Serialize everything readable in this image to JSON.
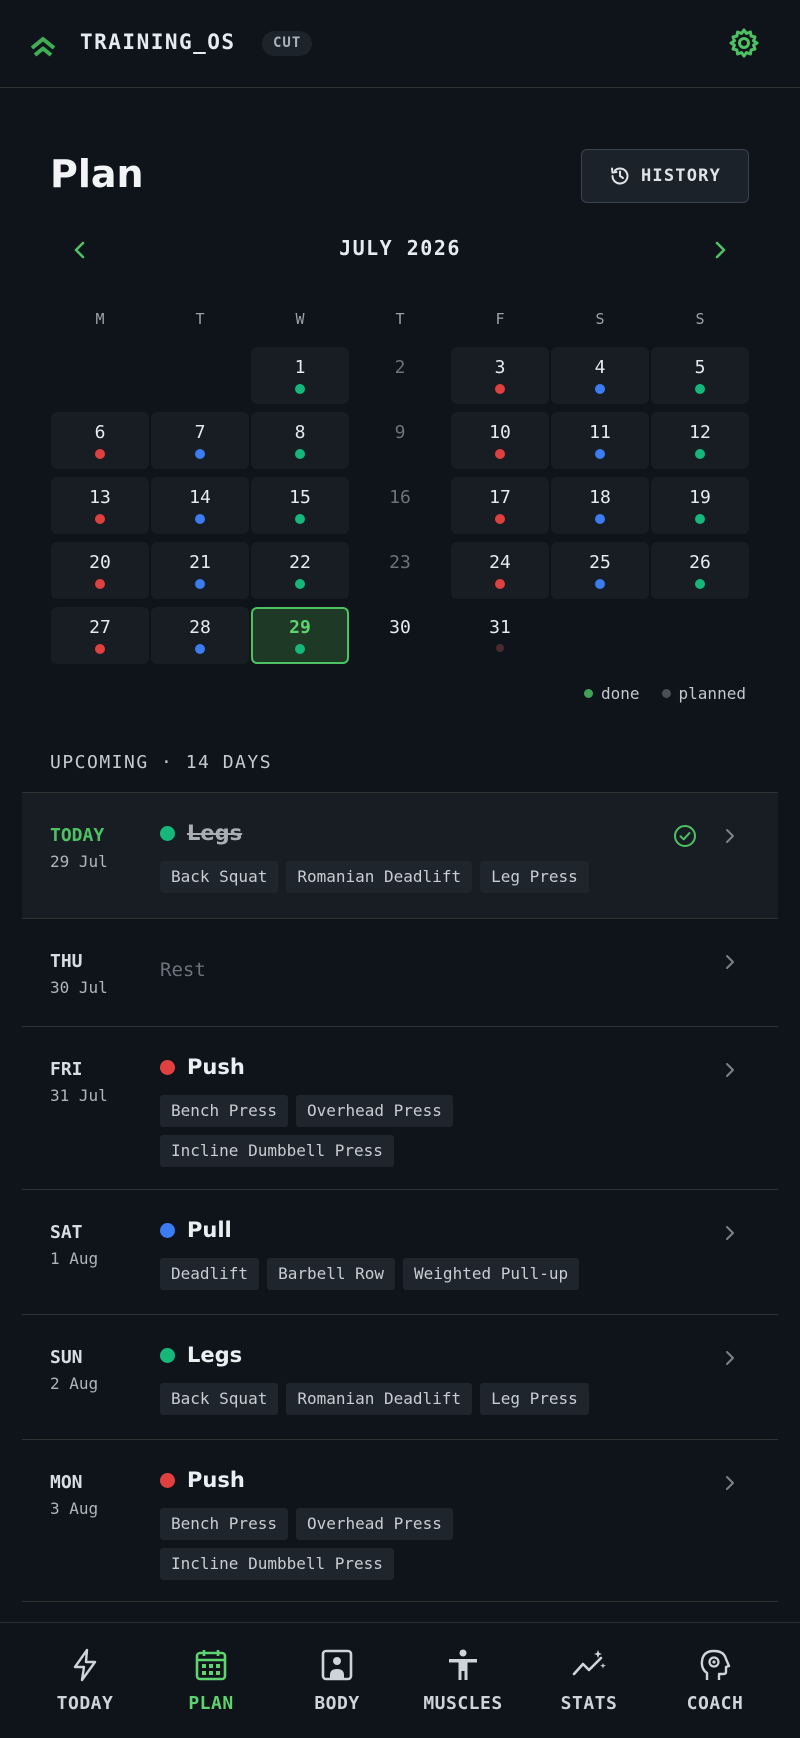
{
  "app": {
    "title": "TRAINING_OS",
    "mode_badge": "CUT"
  },
  "header": {
    "title": "Plan",
    "history_label": "HISTORY"
  },
  "colors": {
    "accent": "#4ec163",
    "push": "#e0403f",
    "pull": "#3b7cf0",
    "legs": "#15b87a",
    "planned": "#4a4f55"
  },
  "calendar": {
    "month_label": "JULY 2026",
    "weekdays": [
      "M",
      "T",
      "W",
      "T",
      "F",
      "S",
      "S"
    ],
    "today": 29,
    "days": [
      {
        "n": "1",
        "type": "legs"
      },
      {
        "n": "2",
        "type": "rest"
      },
      {
        "n": "3",
        "type": "push"
      },
      {
        "n": "4",
        "type": "pull"
      },
      {
        "n": "5",
        "type": "legs"
      },
      {
        "n": "6",
        "type": "push"
      },
      {
        "n": "7",
        "type": "pull"
      },
      {
        "n": "8",
        "type": "legs"
      },
      {
        "n": "9",
        "type": "rest"
      },
      {
        "n": "10",
        "type": "push"
      },
      {
        "n": "11",
        "type": "pull"
      },
      {
        "n": "12",
        "type": "legs"
      },
      {
        "n": "13",
        "type": "push"
      },
      {
        "n": "14",
        "type": "pull"
      },
      {
        "n": "15",
        "type": "legs"
      },
      {
        "n": "16",
        "type": "rest"
      },
      {
        "n": "17",
        "type": "push"
      },
      {
        "n": "18",
        "type": "pull"
      },
      {
        "n": "19",
        "type": "legs"
      },
      {
        "n": "20",
        "type": "push"
      },
      {
        "n": "21",
        "type": "pull"
      },
      {
        "n": "22",
        "type": "legs"
      },
      {
        "n": "23",
        "type": "rest"
      },
      {
        "n": "24",
        "type": "push"
      },
      {
        "n": "25",
        "type": "pull"
      },
      {
        "n": "26",
        "type": "legs"
      },
      {
        "n": "27",
        "type": "push"
      },
      {
        "n": "28",
        "type": "pull"
      },
      {
        "n": "29",
        "type": "legs"
      },
      {
        "n": "30",
        "type": "future"
      },
      {
        "n": "31",
        "type": "planned"
      }
    ],
    "legend": {
      "done": "done",
      "planned": "planned"
    }
  },
  "upcoming": {
    "label": "UPCOMING · 14 DAYS",
    "rows": [
      {
        "day": "TODAY",
        "date": "29 Jul",
        "name": "Legs",
        "type": "legs",
        "done": true,
        "exercises": [
          "Back Squat",
          "Romanian Deadlift",
          "Leg Press"
        ]
      },
      {
        "day": "THU",
        "date": "30 Jul",
        "rest": "Rest"
      },
      {
        "day": "FRI",
        "date": "31 Jul",
        "name": "Push",
        "type": "push",
        "exercises": [
          "Bench Press",
          "Overhead Press",
          "Incline Dumbbell Press"
        ]
      },
      {
        "day": "SAT",
        "date": "1 Aug",
        "name": "Pull",
        "type": "pull",
        "exercises": [
          "Deadlift",
          "Barbell Row",
          "Weighted Pull-up"
        ]
      },
      {
        "day": "SUN",
        "date": "2 Aug",
        "name": "Legs",
        "type": "legs",
        "exercises": [
          "Back Squat",
          "Romanian Deadlift",
          "Leg Press"
        ]
      },
      {
        "day": "MON",
        "date": "3 Aug",
        "name": "Push",
        "type": "push",
        "exercises": [
          "Bench Press",
          "Overhead Press",
          "Incline Dumbbell Press"
        ]
      }
    ]
  },
  "nav": {
    "items": [
      {
        "label": "TODAY",
        "icon": "bolt-icon"
      },
      {
        "label": "PLAN",
        "icon": "calendar-icon",
        "active": true
      },
      {
        "label": "BODY",
        "icon": "body-frame-icon"
      },
      {
        "label": "MUSCLES",
        "icon": "person-icon"
      },
      {
        "label": "STATS",
        "icon": "stats-icon"
      },
      {
        "label": "COACH",
        "icon": "coach-icon"
      }
    ]
  }
}
